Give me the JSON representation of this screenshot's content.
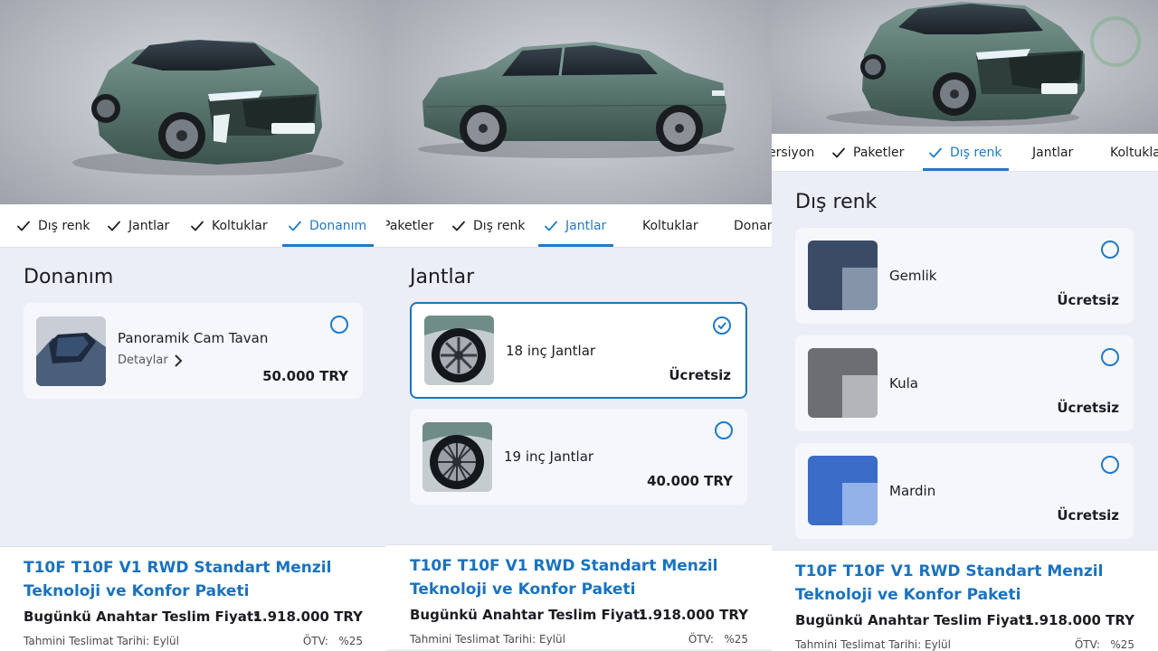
{
  "panels": [
    {
      "tabs": [
        "Dış renk",
        "Jantlar",
        "Koltuklar",
        "Donanım"
      ],
      "active_tab": "Donanım",
      "section_title": "Donanım",
      "card": {
        "name": "Panoramik Cam Tavan",
        "details_label": "Detaylar",
        "price": "50.000 TRY",
        "selected": false
      }
    },
    {
      "tabs": [
        "Paketler",
        "Dış renk",
        "Jantlar",
        "Koltuklar",
        "Donan"
      ],
      "active_tab": "Jantlar",
      "section_title": "Jantlar",
      "cards": [
        {
          "name": "18 inç Jantlar",
          "price": "Ücretsiz",
          "selected": true
        },
        {
          "name": "19 inç Jantlar",
          "price": "40.000 TRY",
          "selected": false
        }
      ]
    },
    {
      "tabs": [
        "ersiyon",
        "Paketler",
        "Dış renk",
        "Jantlar",
        "Koltukla"
      ],
      "active_tab": "Dış renk",
      "section_title": "Dış renk",
      "cards": [
        {
          "name": "Gemlik",
          "price": "Ücretsiz",
          "selected": false,
          "swatch_colors": [
            "#2c3c58",
            "#7c8ba3"
          ]
        },
        {
          "name": "Kula",
          "price": "Ücretsiz",
          "selected": false,
          "swatch_colors": [
            "#6c6e74",
            "#b3b5bb"
          ]
        },
        {
          "name": "Mardin",
          "price": "Ücretsiz",
          "selected": false,
          "swatch_colors": [
            "#3a6cc8",
            "#93b2e8"
          ]
        }
      ]
    }
  ],
  "summary": {
    "title": "T10F T10F V1 RWD Standart Menzil Teknoloji ve Konfor Paketi",
    "price_label": "Bugünkü Anahtar Teslim Fiyat:",
    "price_value": "1.918.000 TRY",
    "delivery_label": "Tahmini Teslimat Tarihi: Eylül",
    "otv_label": "ÖTV:",
    "otv_value": "%25"
  },
  "colors": {
    "accent": "#1f7ac8",
    "car_body": "#5b7a72",
    "background": "#eceef7"
  },
  "icons": [
    "check-icon",
    "chevron-right-icon",
    "radio-icon",
    "radio-checked-icon",
    "togg-logo-icon"
  ]
}
